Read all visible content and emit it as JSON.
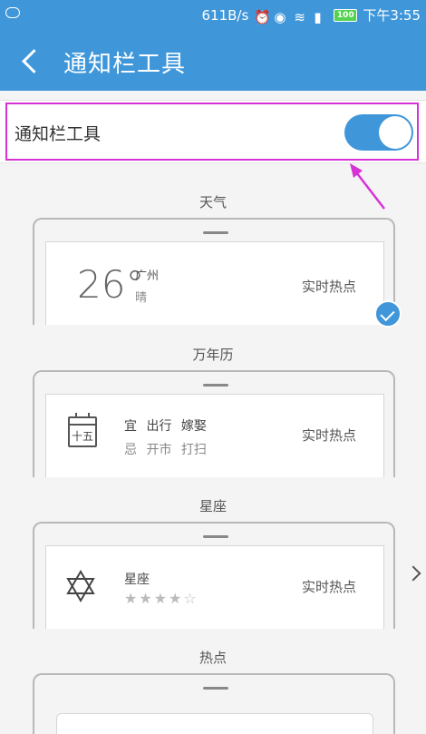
{
  "status_bar": {
    "speed": "611B/s",
    "battery": "100",
    "time": "下午3:55"
  },
  "header": {
    "title": "通知栏工具"
  },
  "toggle": {
    "label": "通知栏工具",
    "on": true
  },
  "sections": {
    "weather": {
      "title": "天气",
      "temperature": "26°",
      "city": "广州",
      "condition": "晴",
      "hot_label": "实时热点",
      "selected": true
    },
    "calendar": {
      "title": "万年历",
      "icon_text": "十五",
      "line1": "宜 出行 嫁娶",
      "line2": "忌 开市 打扫",
      "hot_label": "实时热点"
    },
    "zodiac": {
      "title": "星座",
      "name": "星座",
      "rating_text": "★★★★☆",
      "rating": 4,
      "hot_label": "实时热点"
    },
    "hot": {
      "title": "热点"
    }
  },
  "colors": {
    "accent": "#3f97da",
    "highlight": "#d632d6"
  }
}
